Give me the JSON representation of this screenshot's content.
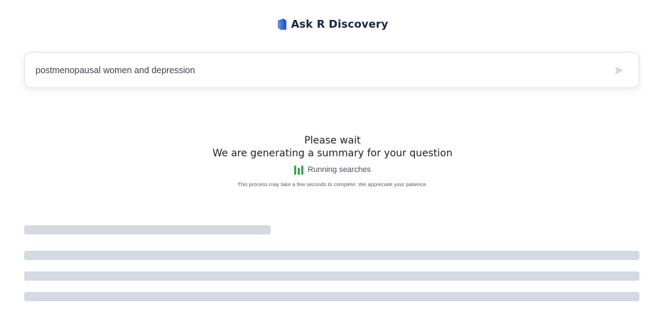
{
  "brand": {
    "name": "Ask R Discovery",
    "logo_icon": "r-discovery-logo-icon",
    "logo_color": "#3d6fe0"
  },
  "search": {
    "value": "postmenopausal women and depression",
    "send_icon": "send-arrow-icon",
    "send_icon_color": "#c9d6e6"
  },
  "status": {
    "title": "Please wait",
    "subtitle": "We are generating a summary for your question",
    "running_icon": "progress-bars-icon",
    "running_icon_color": "#3aa84a",
    "running_label": "Running searches",
    "note": "This process may take a few seconds to complete. We appreciate your patience."
  },
  "skeleton": {
    "color": "#d3dae2"
  }
}
